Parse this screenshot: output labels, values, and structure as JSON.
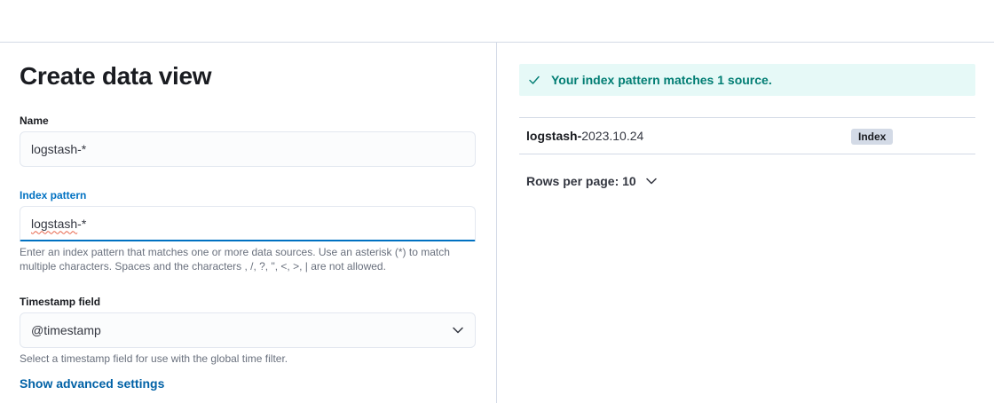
{
  "page": {
    "title": "Create data view"
  },
  "form": {
    "name": {
      "label": "Name",
      "value": "logstash-*"
    },
    "index_pattern": {
      "label": "Index pattern",
      "value_misspelled": "logstash",
      "value_rest": "-*",
      "help": "Enter an index pattern that matches one or more data sources. Use an asterisk (*) to match multiple characters. Spaces and the characters , /, ?, \", <, >, | are not allowed."
    },
    "timestamp": {
      "label": "Timestamp field",
      "value": "@timestamp",
      "help": "Select a timestamp field for use with the global time filter."
    },
    "advanced_link": "Show advanced settings"
  },
  "results": {
    "callout": "Your index pattern matches 1 source.",
    "rows": [
      {
        "name_bold": "logstash-",
        "name_rest": "2023.10.24",
        "badge": "Index"
      }
    ],
    "rows_per_page": "Rows per page: 10"
  },
  "colors": {
    "accent": "#0071c2",
    "link": "#0061a6",
    "success_text": "#017d73",
    "success_bg": "#e6f9f7",
    "badge_bg": "#d3dae6"
  },
  "icons": {
    "callout": "check-icon",
    "timestamp_select": "chevron-down-icon",
    "rows_per_page": "chevron-down-icon"
  }
}
